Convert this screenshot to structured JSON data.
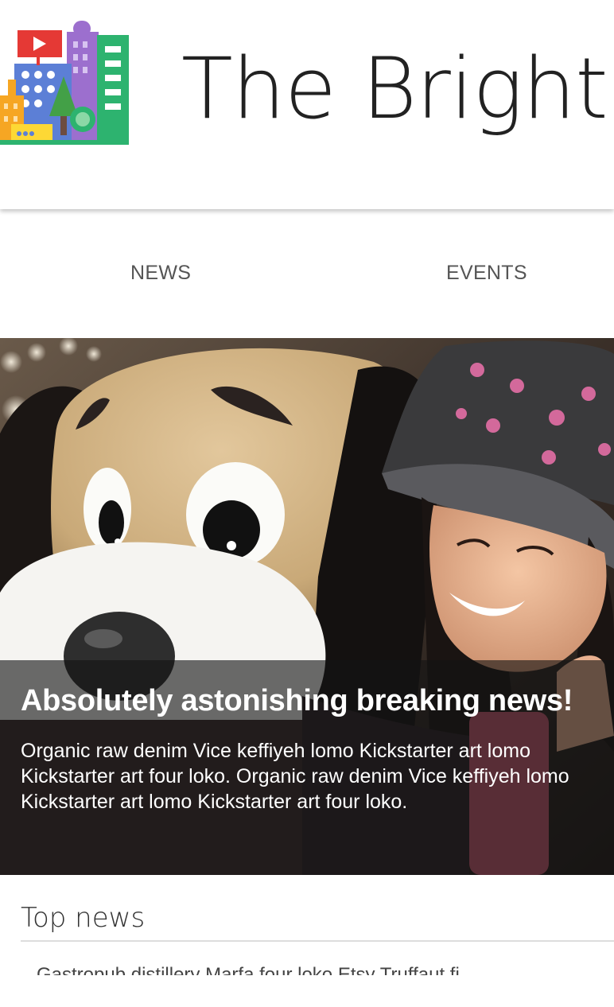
{
  "header": {
    "title": "The Brighto",
    "logo_icon": "city-buildings-logo-icon"
  },
  "nav": {
    "tabs": [
      {
        "label": "NEWS"
      },
      {
        "label": "EVENTS"
      }
    ]
  },
  "hero": {
    "image_icon": "mascot-photo",
    "headline": "Absolutely astonishing breaking news!",
    "body": "Organic raw denim Vice keffiyeh lomo Kickstarter art lomo Kickstarter art four loko. Organic raw denim Vice keffiyeh lomo Kickstarter art lomo Kickstarter art four loko."
  },
  "top_news": {
    "title": "Top news",
    "first_item": "Gastropub distillery Marfa four loko Etsy Truffaut fi"
  },
  "colors": {
    "logo_red": "#e53935",
    "logo_purple": "#9c6fce",
    "logo_blue": "#5c7fd6",
    "logo_green": "#2db36f",
    "logo_orange": "#f6a623",
    "logo_yellow": "#fdd835",
    "caption_overlay": "#141414"
  }
}
